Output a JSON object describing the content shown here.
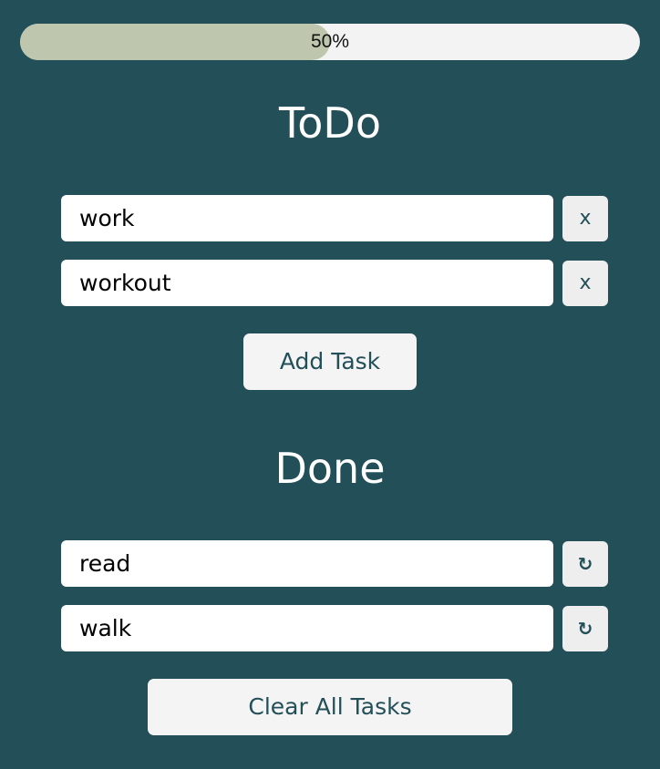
{
  "progress": {
    "label": "50%",
    "fraction": 0.5
  },
  "todo": {
    "title": "ToDo",
    "items": [
      {
        "text": "work",
        "action": "x"
      },
      {
        "text": "workout",
        "action": "x"
      }
    ],
    "add_label": "Add Task"
  },
  "done": {
    "title": "Done",
    "items": [
      {
        "text": "read",
        "action": "↻"
      },
      {
        "text": "walk",
        "action": "↻"
      }
    ],
    "clear_label": "Clear All Tasks"
  },
  "colors": {
    "background": "#234f58",
    "progress_fill": "#bec6ad",
    "progress_track": "#f3f3f3",
    "button_text": "#234f58"
  }
}
